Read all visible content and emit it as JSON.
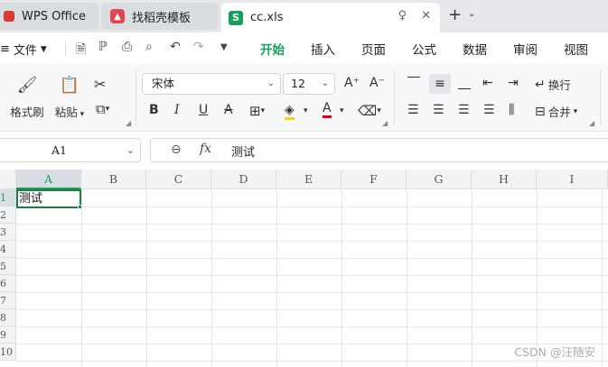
{
  "tabs": {
    "wps": "WPS Office",
    "daoke": "找稻壳模板",
    "active_file": "cc.xls",
    "new_tab": "+",
    "new_tab_dropdown": "⌄"
  },
  "menu": {
    "file": "文件",
    "tabs": [
      "开始",
      "插入",
      "页面",
      "公式",
      "数据",
      "审阅",
      "视图"
    ],
    "active": "开始"
  },
  "ribbon": {
    "format_painter": "格式刷",
    "paste": "粘贴",
    "font_name": "宋体",
    "font_size": "12",
    "wrap_text": "换行",
    "merge": "合并"
  },
  "formula": {
    "cell_ref": "A1",
    "fx": "fx",
    "content": "测试"
  },
  "sheet": {
    "columns": [
      "A",
      "B",
      "C",
      "D",
      "E",
      "F",
      "G",
      "H",
      "I"
    ],
    "rows": [
      "1",
      "2",
      "3",
      "4",
      "5",
      "6",
      "7",
      "8",
      "9",
      "10"
    ],
    "active_col": "A",
    "active_row": "1",
    "a1_value": "测试"
  },
  "watermark": "CSDN @汪随安",
  "colors": {
    "accent": "#17a05d",
    "selection_border": "#1e7f45",
    "wps_red": "#d63b33"
  }
}
